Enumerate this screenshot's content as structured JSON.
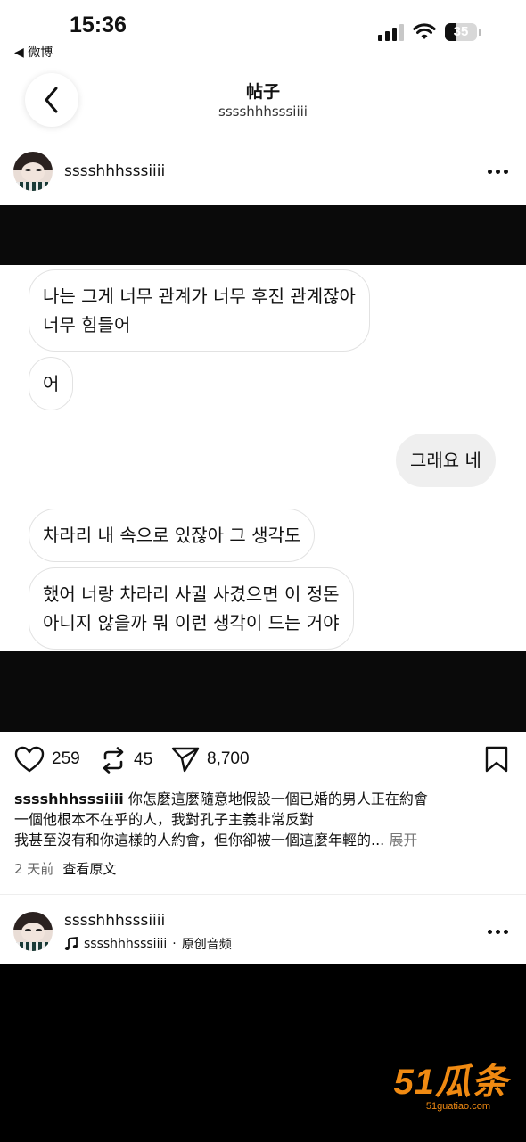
{
  "status_bar": {
    "time": "15:36",
    "back_app": "◀ 微博",
    "battery": "35",
    "battery_level_percent": 35
  },
  "header": {
    "title": "帖子",
    "subtitle": "sssshhhsssiiii"
  },
  "post": {
    "author": "sssshhhsssiiii",
    "messages": [
      {
        "side": "received",
        "lines": [
          "나는 그게 너무 관계가 너무 후진 관계잖아",
          "너무 힘들어"
        ]
      },
      {
        "side": "received",
        "lines": [
          "어"
        ]
      },
      {
        "side": "sent",
        "lines": [
          "그래요 네"
        ]
      },
      {
        "side": "received",
        "lines": [
          "차라리 내 속으로 있잖아 그 생각도"
        ]
      },
      {
        "side": "received",
        "lines": [
          "했어 너랑 차라리 사귈 사겼으면 이 정돈",
          "아니지 않을까 뭐 이런 생각이 드는 거야"
        ]
      }
    ],
    "actions": {
      "likes": "259",
      "reposts": "45",
      "shares": "8,700"
    },
    "caption": {
      "user": "sssshhhsssiiii",
      "line1": " 你怎麼這麼隨意地假設一個已婚的男人正在約會",
      "line2": "一個他根本不在乎的人，我對孔子主義非常反對",
      "line3": " 我甚至沒有和你這樣的人約會，但你卻被一個這麼年輕的...",
      "more": " 展开"
    },
    "time_ago": "2 天前",
    "view_original": "查看原文"
  },
  "next_post": {
    "author": "sssshhhsssiiii",
    "audio_user": "sssshhhsssiiii",
    "audio_separator": " · ",
    "audio_label": "原创音频"
  },
  "watermark": {
    "main": "51瓜条",
    "url": "51guatiao.com"
  },
  "icons": [
    "chevron-left-icon",
    "heart-icon",
    "repost-icon",
    "share-icon",
    "bookmark-icon",
    "more-icon",
    "music-note-icon",
    "wifi-icon",
    "signal-icon",
    "battery-icon"
  ]
}
